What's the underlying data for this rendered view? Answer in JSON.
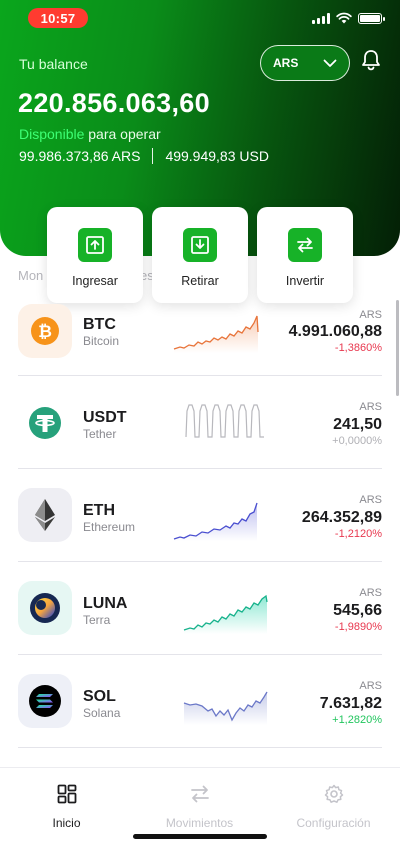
{
  "status": {
    "time": "10:57"
  },
  "header": {
    "balance_label": "Tu balance",
    "currency": "ARS",
    "balance": "220.856.063,60",
    "available_highlight": "Disponible",
    "available_rest": " para operar",
    "ars_amount": "99.986.373,86 ARS",
    "usd_amount": "499.949,83 USD"
  },
  "actions": [
    {
      "label": "Ingresar",
      "icon": "arrow-up-box-icon"
    },
    {
      "label": "Retirar",
      "icon": "arrow-down-box-icon"
    },
    {
      "label": "Invertir",
      "icon": "swap-icon"
    }
  ],
  "colors": {
    "accent": "#17b228",
    "negative": "#e8384f",
    "positive": "#22c55e",
    "neutral": "#b0b0b5"
  },
  "coins": [
    {
      "symbol": "BTC",
      "name": "Bitcoin",
      "currency": "ARS",
      "price": "4.991.060,88",
      "change": "-1,3860%",
      "trend": "negative",
      "logo": "bitcoin-logo-icon"
    },
    {
      "symbol": "USDT",
      "name": "Tether",
      "currency": "ARS",
      "price": "241,50",
      "change": "+0,0000%",
      "trend": "neutral",
      "logo": "tether-logo-icon"
    },
    {
      "symbol": "ETH",
      "name": "Ethereum",
      "currency": "ARS",
      "price": "264.352,89",
      "change": "-1,2120%",
      "trend": "negative",
      "logo": "ethereum-logo-icon"
    },
    {
      "symbol": "LUNA",
      "name": "Terra",
      "currency": "ARS",
      "price": "545,66",
      "change": "-1,9890%",
      "trend": "negative",
      "logo": "terra-logo-icon"
    },
    {
      "symbol": "SOL",
      "name": "Solana",
      "currency": "ARS",
      "price": "7.631,82",
      "change": "+1,2820%",
      "trend": "positive",
      "logo": "solana-logo-icon"
    }
  ],
  "nav": [
    {
      "label": "Inicio",
      "icon": "grid-icon",
      "active": true
    },
    {
      "label": "Movimientos",
      "icon": "transfer-arrows-icon",
      "active": false
    },
    {
      "label": "Configuración",
      "icon": "gear-icon",
      "active": false
    }
  ]
}
